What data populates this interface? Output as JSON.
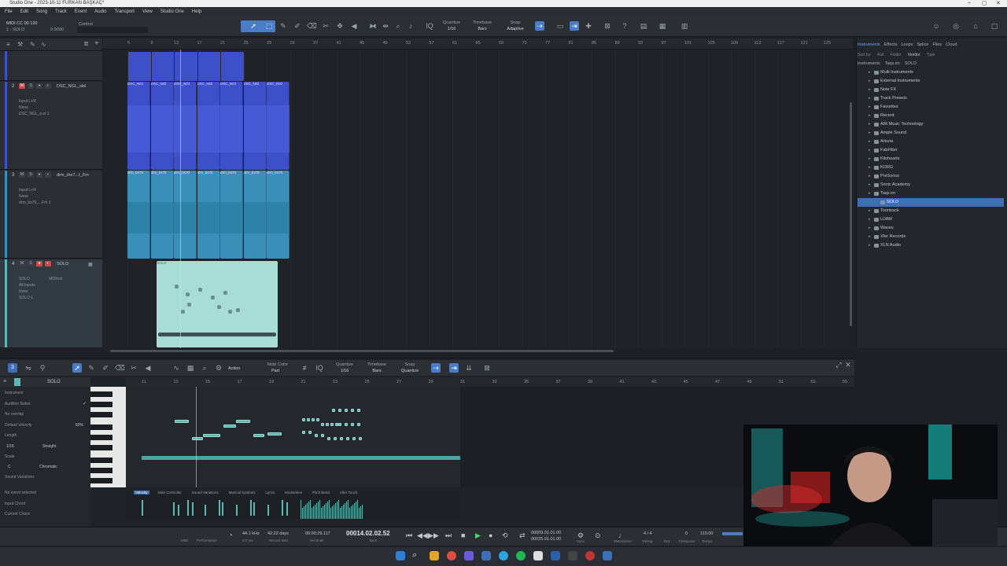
{
  "window": {
    "title": "Studio One - 2023-10-11 FURKAN BAŞKAÇ*"
  },
  "menu": [
    "File",
    "Edit",
    "Song",
    "Track",
    "Event",
    "Audio",
    "Transport",
    "View",
    "Studio One",
    "Help"
  ],
  "toolbar": {
    "midi_label": "MIDI CC 00 120",
    "midi_sub": "1 - SOLO",
    "midi_value": "0.0000",
    "control_label": "Control",
    "quantize_label": "Quantize",
    "quantize_value": "1/16",
    "timebase_label": "Timebase",
    "timebase_value": "Bars",
    "snap_label": "Snap",
    "snap_value": "Adaptive"
  },
  "ruler": [
    "5",
    "9",
    "13",
    "17",
    "21",
    "25",
    "29",
    "33",
    "37",
    "41",
    "45",
    "49",
    "53",
    "57",
    "61",
    "65",
    "69",
    "73",
    "77",
    "81",
    "85",
    "89",
    "93",
    "97",
    "101",
    "105",
    "109",
    "113",
    "117",
    "121",
    "125"
  ],
  "tracks": [
    {
      "num": "2",
      "name": "DSC_NGL_slel",
      "input": "Input L+R",
      "none": "None",
      "out": "DSC_NGL_s.st 1"
    },
    {
      "num": "3",
      "name": "drm_dre7...t_Fm",
      "input": "Input L+R",
      "none": "None",
      "out": "drm_bs70_...Fm 1"
    },
    {
      "num": "4",
      "name": "SOLO",
      "input": "SOLO",
      "midi": "MIDInst",
      "all_inputs": "All Inputs",
      "none": "None",
      "out": "SOLO 1"
    }
  ],
  "clips": {
    "dsc_label": "DSC_NGl",
    "drm_label": "drm_bs70",
    "midi_label": "SOLO"
  },
  "browser": {
    "tabs": [
      "Instruments",
      "Effects",
      "Loops",
      "Splice",
      "Files",
      "Cloud"
    ],
    "active_tab": "Instruments",
    "filters": [
      "Sort by:",
      "Flat",
      "Folder",
      "Vendor",
      "Type"
    ],
    "path": [
      "Instruments",
      "Taqs.im",
      "SOLO"
    ],
    "items": [
      "Multi Instruments",
      "External Instruments",
      "Note FX",
      "Track Presets",
      "Favorites",
      "Recent",
      "AIR Music Technology",
      "Ample Sound",
      "Arturia",
      "FabFilter",
      "Kilohearts",
      "KORG",
      "PreSonus",
      "Sonic Academy",
      "Taqs.im",
      "SOLO",
      "Toontrack",
      "UJAM",
      "Waves",
      "Xfer Records",
      "XLN Audio"
    ],
    "selected": "SOLO"
  },
  "editor": {
    "track_name": "SOLO",
    "action_label": "Action",
    "note_color_label": "Note Color",
    "note_color_value": "Part",
    "quantize_label": "Quantize",
    "quantize_value": "1/16",
    "timebase_label": "Timebase",
    "timebase_value": "Bars",
    "snap_label": "Snap",
    "snap_value": "Quantize",
    "ruler": [
      "11",
      "13",
      "15",
      "17",
      "19",
      "21",
      "23",
      "25",
      "27",
      "29",
      "31",
      "33",
      "35",
      "37",
      "39",
      "41",
      "43",
      "45",
      "47",
      "49",
      "51",
      "53",
      "55"
    ],
    "inspector": {
      "instrument": "Instrument",
      "audition": "Audition Notes",
      "no_overlap": "No overlap",
      "default_velocity": "Default Velocity",
      "default_velocity_value": "80%",
      "length": "Length",
      "length_value": "1/16",
      "straight": "Straight",
      "scale": "Scale",
      "scale_key": "C",
      "scale_value": "Chromatic",
      "sound_variations": "Sound Variations",
      "no_event": "No event selected",
      "input_chord": "Input Chord",
      "current_chord": "Current Chord"
    },
    "lane_tabs": [
      "Velocity",
      "Note Controller",
      "Sound Variations",
      "Musical Symbols",
      "Lyrics",
      "Modulation",
      "Pitch Bend",
      "After Touch"
    ],
    "active_lane": "Velocity"
  },
  "transport": {
    "midi_label": "MIDI",
    "performance_label": "Performance",
    "sample_rate": "44.1 kHz",
    "latency": "0.0 ms",
    "record_max": "42:22 days",
    "record_max_label": "Record Max",
    "seconds": "00:00:29.117",
    "seconds_label": "Seconds",
    "position": "00014.02.02.52",
    "position_label": "Bars",
    "loop_start": "00009.01.01.00",
    "loop_end": "00025.01.01.00",
    "sync_label": "Sync",
    "metronome_label": "Metronome",
    "timesig": "4 / 4",
    "timing_label": "Timing",
    "key_label": "Key",
    "transpose": "0",
    "transpose_label": "Transpose",
    "tempo": "110.00",
    "tempo_label": "Tempo"
  },
  "colors": {
    "accent": "#4a7cc7",
    "dsc_clip": "#3d4fc9",
    "drm_clip": "#3a8fb8",
    "midi_clip": "#a8ddd6",
    "note": "#5fb7b1"
  }
}
